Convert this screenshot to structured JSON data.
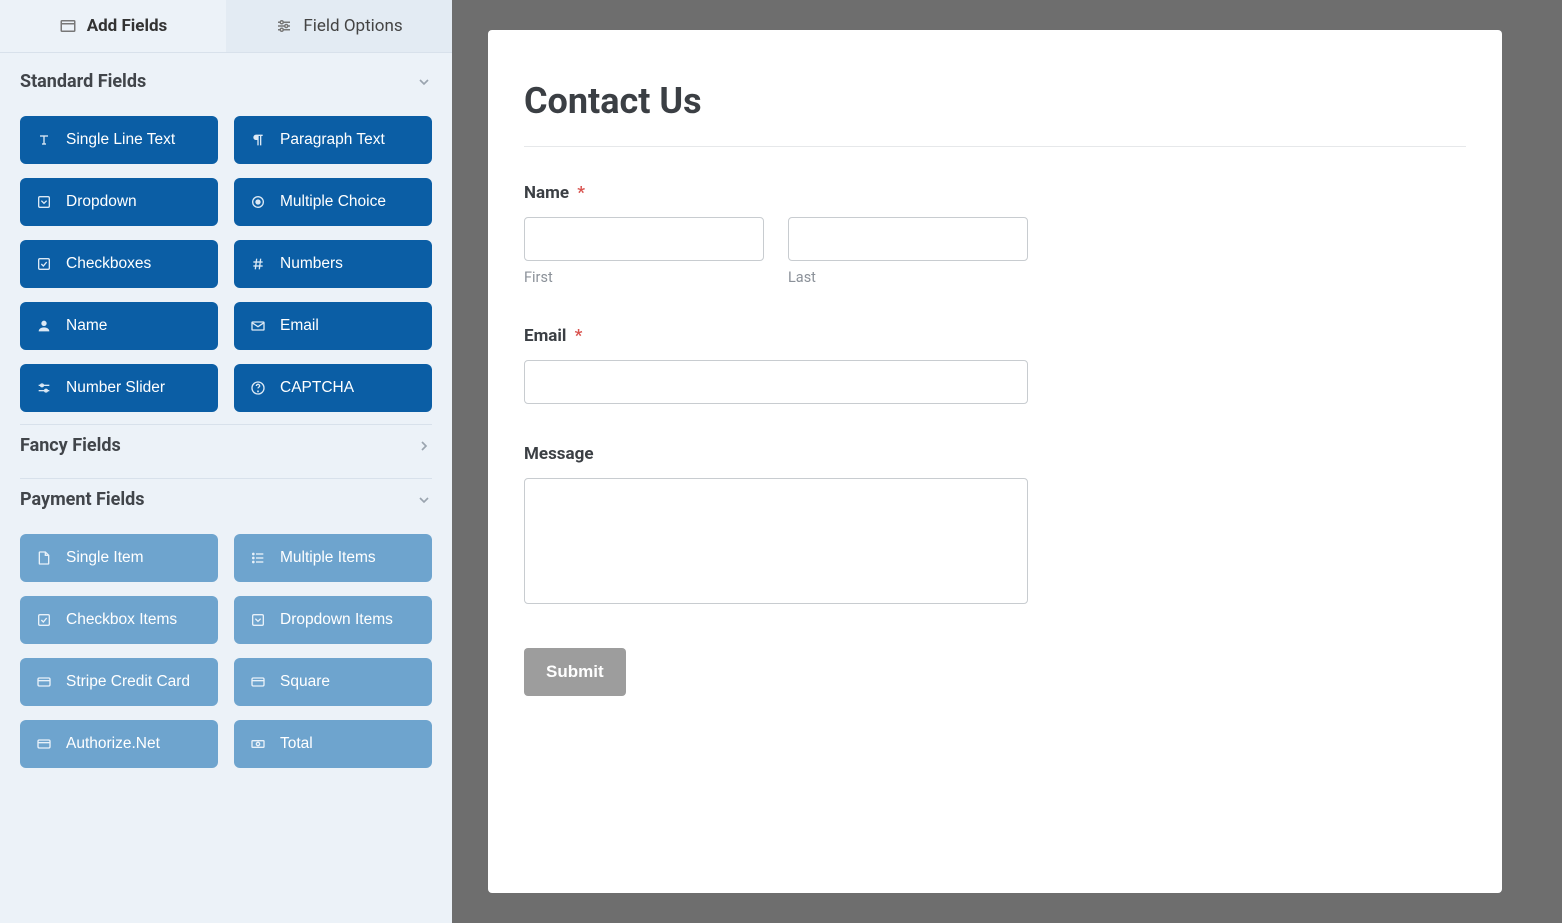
{
  "tabs": {
    "add": "Add Fields",
    "options": "Field Options"
  },
  "sections": {
    "standard": {
      "title": "Standard Fields",
      "fields": {
        "single_line": "Single Line Text",
        "paragraph": "Paragraph Text",
        "dropdown": "Dropdown",
        "multiple_choice": "Multiple Choice",
        "checkboxes": "Checkboxes",
        "numbers": "Numbers",
        "name": "Name",
        "email": "Email",
        "slider": "Number Slider",
        "captcha": "CAPTCHA"
      }
    },
    "fancy": {
      "title": "Fancy Fields"
    },
    "payment": {
      "title": "Payment Fields",
      "fields": {
        "single_item": "Single Item",
        "multiple_items": "Multiple Items",
        "checkbox_items": "Checkbox Items",
        "dropdown_items": "Dropdown Items",
        "stripe": "Stripe Credit Card",
        "square": "Square",
        "authorize": "Authorize.Net",
        "total": "Total"
      }
    }
  },
  "form": {
    "title": "Contact Us",
    "name_label": "Name",
    "first_label": "First",
    "last_label": "Last",
    "email_label": "Email",
    "message_label": "Message",
    "submit_label": "Submit",
    "required_mark": "*"
  }
}
